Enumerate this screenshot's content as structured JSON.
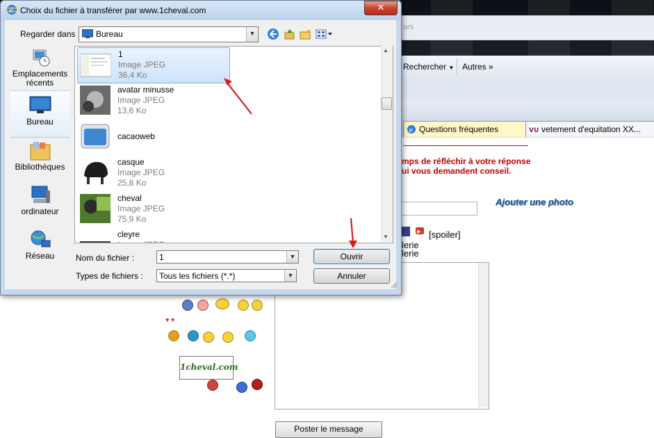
{
  "dialog": {
    "title": "Choix du fichier à transférer par www.1cheval.com",
    "close_label": "✕",
    "look_in_label": "Regarder dans :",
    "look_in_value": "Bureau",
    "filename_label": "Nom du fichier :",
    "filename_value": "1",
    "filetype_label": "Types de fichiers :",
    "filetype_value": "Tous les fichiers (*.*)",
    "open_button": "Ouvrir",
    "cancel_button": "Annuler"
  },
  "places": [
    {
      "label": "Emplacements récents",
      "icon": "recent-places-icon"
    },
    {
      "label": "Bureau",
      "icon": "desktop-icon"
    },
    {
      "label": "Bibliothèques",
      "icon": "libraries-icon"
    },
    {
      "label": "ordinateur",
      "icon": "computer-icon"
    },
    {
      "label": "Réseau",
      "icon": "network-icon"
    }
  ],
  "files": [
    {
      "name": "1",
      "type": "Image JPEG",
      "size": "36,4 Ko"
    },
    {
      "name": "avatar minusse",
      "type": "Image JPEG",
      "size": "13,6 Ko"
    },
    {
      "name": "cacaoweb",
      "type": "",
      "size": ""
    },
    {
      "name": "casque",
      "type": "Image JPEG",
      "size": "25,8 Ko"
    },
    {
      "name": "cheval",
      "type": "Image JPEG",
      "size": "75,9 Ko"
    },
    {
      "name": "cleyre",
      "type": "Image JPEG",
      "size": ""
    }
  ],
  "browser": {
    "url_fragment": "urs",
    "toolbar_search": "Rechercher",
    "toolbar_more": "Autres »",
    "tabs": [
      "Questions fréquentes",
      "vetement d'equitation XX..."
    ],
    "warning_line1": "mps de réfléchir à votre réponse",
    "warning_line2": "ui vous demandent conseil.",
    "add_photo": "Ajouter une photo",
    "spoiler": "[spoiler]",
    "gallery1": "lerie",
    "gallery2": "lerie",
    "logo": "1cheval.com",
    "post_button": "Poster le message"
  },
  "colors": {
    "accent_red": "#c00000",
    "selection_blue": "#cde4fb",
    "dialog_frame": "#c6d8ed"
  }
}
